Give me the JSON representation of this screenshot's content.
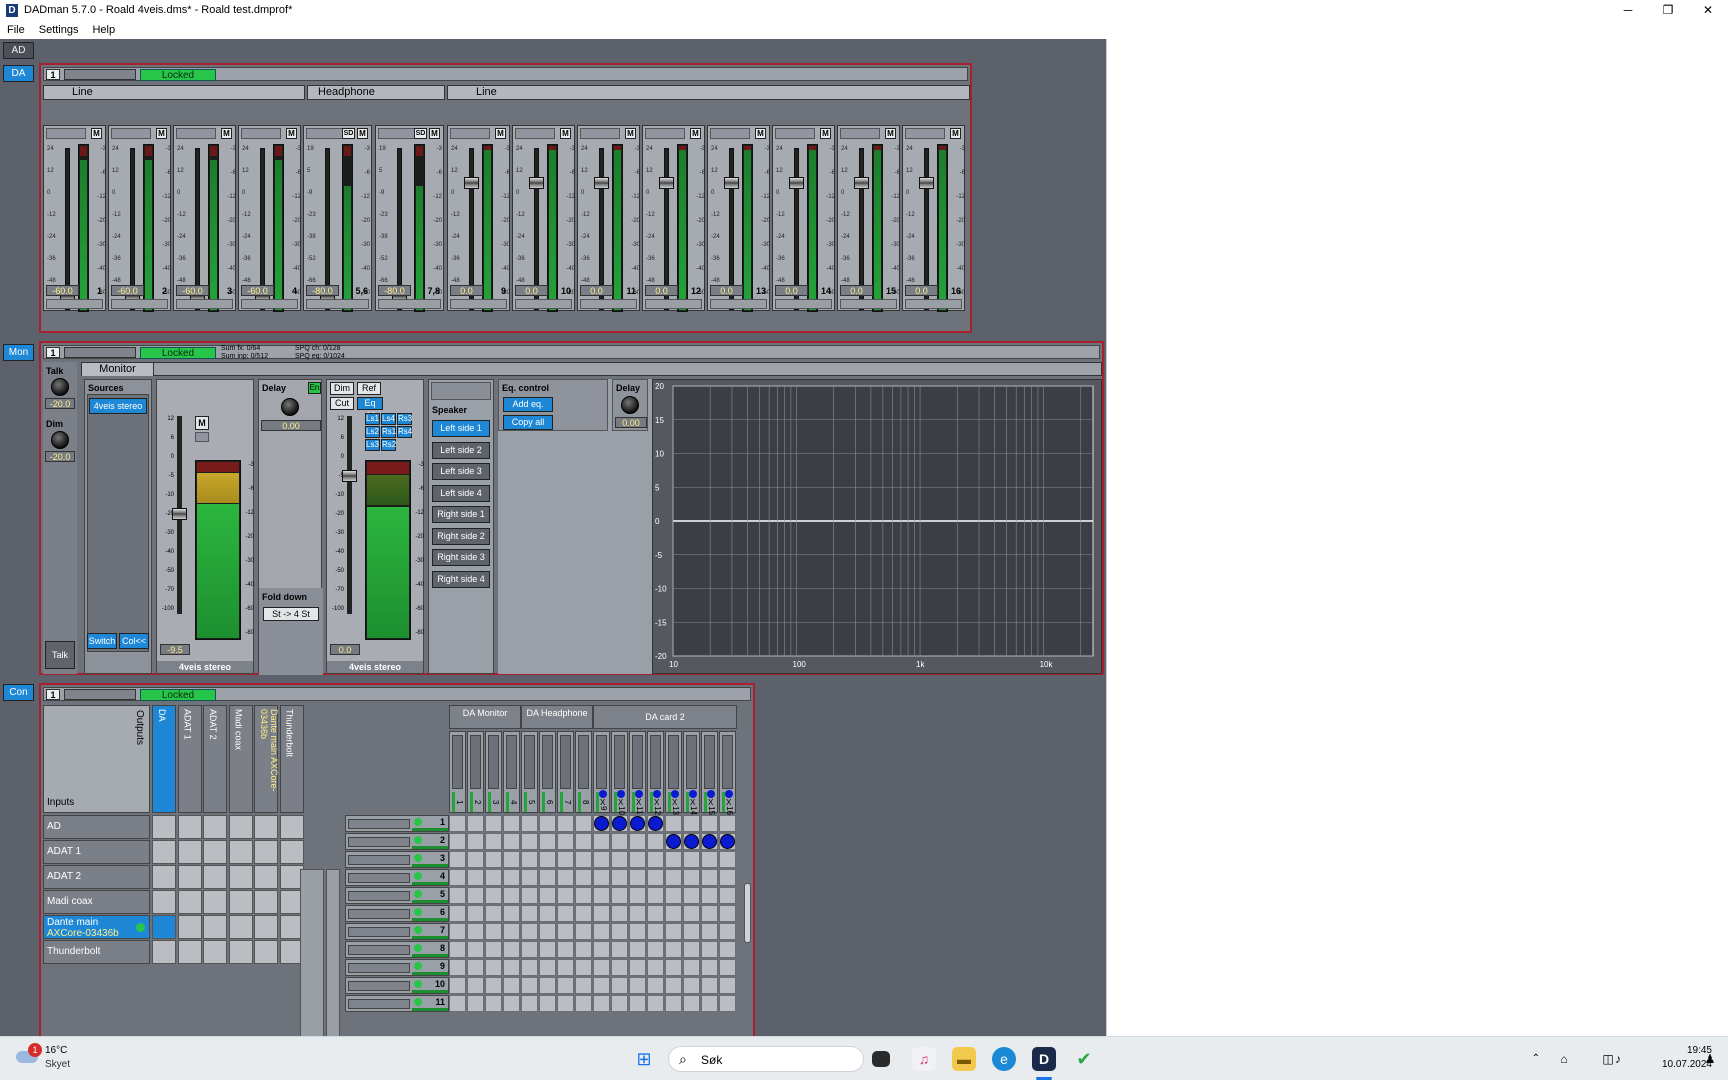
{
  "window": {
    "title": "DADman 5.7.0 - Roald 4veis.dms* - Roald test.dmprof*",
    "minimize": "─",
    "maximize": "❐",
    "close": "✕"
  },
  "menu": [
    "File",
    "Settings",
    "Help"
  ],
  "sidetabs": {
    "ad": "AD",
    "da": "DA",
    "mon": "Mon",
    "con": "Con"
  },
  "da": {
    "unit_number": "1",
    "status": "Locked",
    "groups": [
      "Line",
      "Headphone",
      "Line"
    ],
    "channels": [
      {
        "value": "-60.0",
        "label": "1"
      },
      {
        "value": "-60.0",
        "label": "2"
      },
      {
        "value": "-60.0",
        "label": "3"
      },
      {
        "value": "-60.0",
        "label": "4"
      },
      {
        "value": "-80.0",
        "label": "5,6"
      },
      {
        "value": "-80.0",
        "label": "7,8"
      },
      {
        "value": "0.0",
        "label": "9"
      },
      {
        "value": "0.0",
        "label": "10"
      },
      {
        "value": "0.0",
        "label": "11"
      },
      {
        "value": "0.0",
        "label": "12"
      },
      {
        "value": "0.0",
        "label": "13"
      },
      {
        "value": "0.0",
        "label": "14"
      },
      {
        "value": "0.0",
        "label": "15"
      },
      {
        "value": "0.0",
        "label": "16"
      }
    ],
    "mute_label": "M",
    "sd_label": "SD",
    "scale_line": [
      "24",
      "12",
      "0",
      "-12",
      "-24",
      "-36",
      "-48",
      "-60"
    ],
    "scale_hp": [
      "19",
      "5",
      "-9",
      "-23",
      "-38",
      "-52",
      "-66",
      "-80"
    ],
    "meter_scale": [
      "-3",
      "-6",
      "-12",
      "-20",
      "-30",
      "-40",
      "-60"
    ]
  },
  "mon": {
    "unit_number": "1",
    "status": "Locked",
    "stats": {
      "sum_fx": "Sum fx: 0/64",
      "sum_inp": "Sum inp: 0/512",
      "spq_ch": "SPQ ch: 0/128",
      "spq_eq": "SPQ eq: 0/1024"
    },
    "monitor_tab": "Monitor",
    "talk_label": "Talk",
    "talk_value": "-20.0",
    "dim_label": "Dim",
    "dim_value": "-20.0",
    "talk_button": "Talk",
    "sources_label": "Sources",
    "source_item": "4veis stereo",
    "switch_button": "Switch",
    "col_button": "Col<<",
    "mute_label": "M",
    "monitor_value": "-9.5",
    "monitor_name": "4veis stereo",
    "fader_scale": [
      "12",
      "6",
      "0",
      "-5",
      "-10",
      "-20",
      "-30",
      "-40",
      "-50",
      "-70",
      "-100"
    ],
    "meter_scale": [
      "-3",
      "-6",
      "-12",
      "-20",
      "-30",
      "-40",
      "-60",
      "-80"
    ],
    "delay_label": "Delay",
    "en_label": "En",
    "delay_value": "0.00",
    "fold_down_label": "Fold down",
    "fold_down_value": "St -> 4 St",
    "dim_button": "Dim",
    "ref_button": "Ref",
    "cut_button": "Cut",
    "eq_button": "Eq <<",
    "speaker_tags": [
      "Ls1",
      "Ls4",
      "Rs3",
      "Ls2",
      "Rs1",
      "Rs4",
      "Ls3",
      "Rs2"
    ],
    "out_value": "0.0",
    "out_name": "4veis stereo",
    "speaker_label": "Speaker",
    "speakers": [
      "Left side 1",
      "Left side 2",
      "Left side 3",
      "Left side 4",
      "Right side 1",
      "Right side 2",
      "Right side 3",
      "Right side 4"
    ],
    "eq_control_label": "Eq. control",
    "add_eq": "Add eq.",
    "copy_all": "Copy all",
    "delay2_label": "Delay",
    "delay2_value": "0.00",
    "eq_y_ticks": [
      "20",
      "15",
      "10",
      "5",
      "0",
      "-5",
      "-10",
      "-15",
      "-20"
    ],
    "eq_x_ticks": [
      "10",
      "100",
      "1k",
      "10k"
    ]
  },
  "con": {
    "unit_number": "1",
    "status": "Locked",
    "outputs_label": "Outputs",
    "inputs_label": "Inputs",
    "output_columns": [
      "DA",
      "ADAT 1",
      "ADAT 2",
      "Madi coax",
      "Dante main AXCore-03436b",
      "Thunderbolt"
    ],
    "input_rows": [
      "AD",
      "ADAT 1",
      "ADAT 2",
      "Madi coax",
      "Dante main",
      "Thunderbolt"
    ],
    "dante_sub": "AXCore-03436b",
    "groups": [
      "DA Monitor",
      "DA Headphone",
      "DA card 2"
    ],
    "col_numbers": [
      "1",
      "2",
      "3",
      "4",
      "5",
      "6",
      "7",
      "8",
      "9",
      "10",
      "11",
      "12",
      "13",
      "14",
      "15",
      "16"
    ],
    "row_numbers": [
      "1",
      "2",
      "3",
      "4",
      "5",
      "6",
      "7",
      "8",
      "9",
      "10",
      "11"
    ],
    "x_mark": "X"
  },
  "taskbar": {
    "temp": "16°C",
    "weather": "Skyet",
    "badge": "1",
    "search": "Søk",
    "time": "19:45",
    "date": "10.07.2024"
  }
}
